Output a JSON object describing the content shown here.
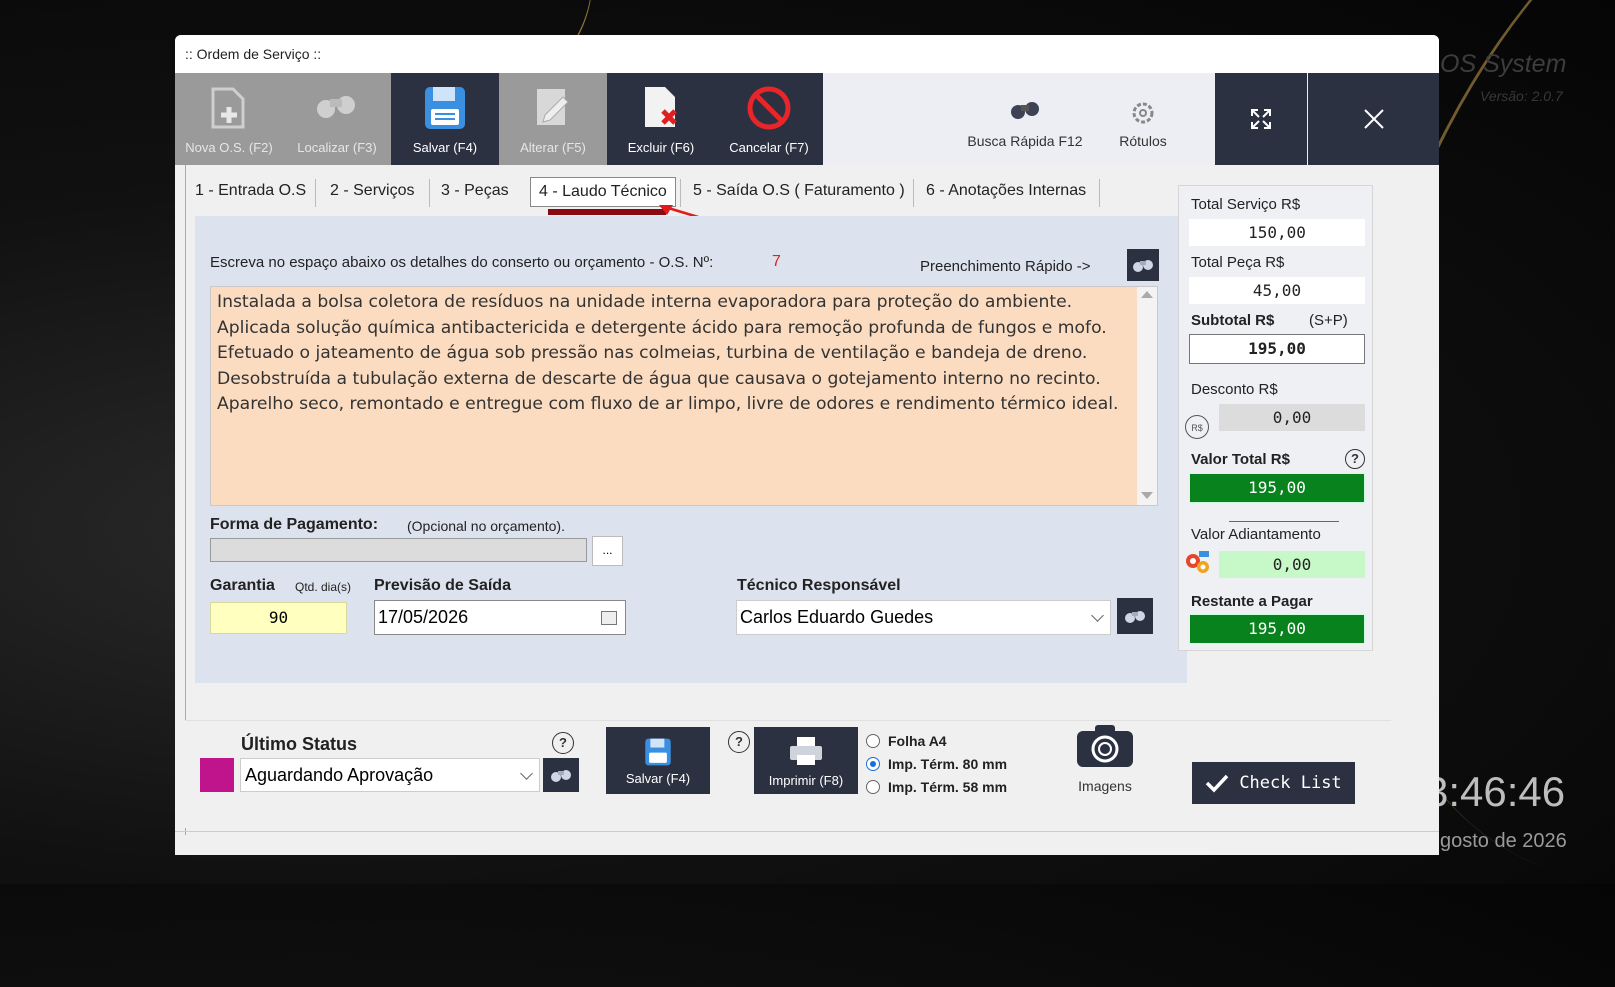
{
  "background": {
    "brand": "OS System",
    "version": "Versão: 2.0.7",
    "clock": "3:46:46",
    "date": "gosto de 2026"
  },
  "window": {
    "title": ":: Ordem de Serviço ::"
  },
  "toolbar": {
    "new_label": "Nova O.S. (F2)",
    "find_label": "Localizar (F3)",
    "save_label": "Salvar (F4)",
    "edit_label": "Alterar  (F5)",
    "delete_label": "Excluir (F6)",
    "cancel_label": "Cancelar (F7)",
    "quick_search_label": "Busca Rápida F12",
    "labels_label": "Rótulos"
  },
  "tabs": [
    {
      "label": "1 - Entrada O.S"
    },
    {
      "label": "2 - Serviços"
    },
    {
      "label": "3 - Peças"
    },
    {
      "label": "4 - Laudo Técnico"
    },
    {
      "label": "5 - Saída O.S ( Faturamento )"
    },
    {
      "label": "6 - Anotações Internas"
    }
  ],
  "laudo": {
    "instruction": "Escreva no espaço abaixo os detalhes do conserto ou orçamento - O.S. Nº:",
    "os_number": "7",
    "quick_fill_label": "Preenchimento Rápido ->",
    "report_text": "Instalada a bolsa coletora de resíduos na unidade interna evaporadora para proteção do ambiente. Aplicada solução química antibactericida e detergente ácido para remoção profunda de fungos e mofo. Efetuado o jateamento de água sob pressão nas colmeias, turbina de ventilação e bandeja de dreno. Desobstruída a tubulação externa de descarte de água que causava o gotejamento interno no recinto. Aparelho seco, remontado e entregue com fluxo de ar limpo, livre de odores e rendimento térmico ideal.",
    "payment_label": "Forma de Pagamento:",
    "payment_optional": "(Opcional no orçamento).",
    "payment_value": "",
    "payment_button": "...",
    "warranty_label": "Garantia",
    "warranty_unit": "Qtd. dia(s)",
    "warranty_value": "90",
    "exit_label": "Previsão de Saída",
    "exit_value": "17/05/2026",
    "tech_label": "Técnico Responsável",
    "tech_value": "Carlos Eduardo Guedes"
  },
  "totals": {
    "service_label": "Total Serviço R$",
    "service_value": "150,00",
    "parts_label": "Total Peça R$",
    "parts_value": "45,00",
    "subtotal_label": "Subtotal R$",
    "subtotal_hint": "(S+P)",
    "subtotal_value": "195,00",
    "discount_label": "Desconto R$",
    "discount_icon": "R$",
    "discount_value": "0,00",
    "total_label": "Valor Total R$",
    "total_value": "195,00",
    "advance_label": "Valor Adiantamento",
    "advance_value": "0,00",
    "remaining_label": "Restante a Pagar",
    "remaining_value": "195,00",
    "help": "?"
  },
  "bottom": {
    "status_label": "Último Status",
    "status_value": "Aguardando Aprovação",
    "status_color": "#c0148d",
    "save_label": "Salvar (F4)",
    "print_label": "Imprimir (F8)",
    "help": "?",
    "print_options": [
      "Folha A4",
      "Imp. Térm. 80 mm",
      "Imp. Térm. 58 mm"
    ],
    "print_selected": "Imp. Térm. 80 mm",
    "images_label": "Imagens",
    "checklist_label": "Check List"
  }
}
